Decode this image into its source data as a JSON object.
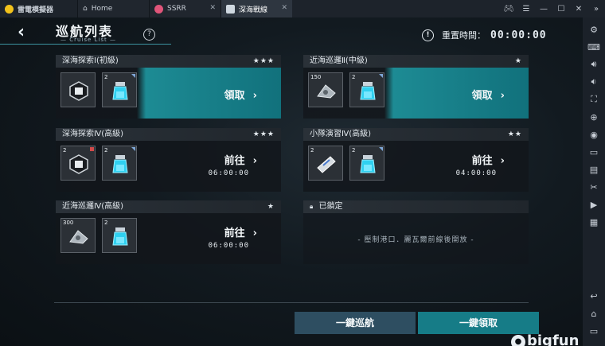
{
  "window": {
    "app_name": "雷電模擬器",
    "tabs": [
      {
        "label": "Home"
      },
      {
        "label": "SSRR"
      },
      {
        "label": "深海戰線"
      }
    ],
    "controls": [
      "gamepad-icon",
      "menu-icon",
      "minimize-icon",
      "maximize-icon",
      "close-icon",
      "collapse-icon"
    ]
  },
  "sidebar": {
    "icons": [
      "settings-icon",
      "keyboard-icon",
      "volume-up-icon",
      "volume-down-icon",
      "screenshot-icon",
      "add-app-icon",
      "record-icon",
      "folder-icon",
      "apk-icon",
      "scissors-icon",
      "video-icon",
      "multi-instance-icon",
      "back-icon",
      "home-icon",
      "recent-apps-icon"
    ]
  },
  "header": {
    "title": "巡航列表",
    "subtitle": "— Cruise List —",
    "help": "?",
    "reset_label": "重置時間：",
    "reset_time": "00:00:00"
  },
  "cards": [
    {
      "name": "深海探索Ⅰ(初級)",
      "stars": "★★★",
      "items": [
        {
          "count": "",
          "type": "cube"
        },
        {
          "count": "2",
          "type": "vial"
        }
      ],
      "action": "領取",
      "time": "",
      "claimable": true
    },
    {
      "name": "近海巡邏Ⅱ(中級)",
      "stars": "★",
      "items": [
        {
          "count": "150",
          "type": "part"
        },
        {
          "count": "2",
          "type": "vial"
        }
      ],
      "action": "領取",
      "time": "",
      "claimable": true
    },
    {
      "name": "深海探索Ⅳ(高級)",
      "stars": "★★★",
      "items": [
        {
          "count": "2",
          "type": "cube"
        },
        {
          "count": "2",
          "type": "vial"
        }
      ],
      "action": "前往",
      "time": "06:00:00",
      "claimable": false
    },
    {
      "name": "小隊演習Ⅳ(高級)",
      "stars": "★★",
      "items": [
        {
          "count": "2",
          "type": "ticket"
        },
        {
          "count": "2",
          "type": "vial"
        }
      ],
      "action": "前往",
      "time": "04:00:00",
      "claimable": false
    },
    {
      "name": "近海巡邏Ⅳ(高級)",
      "stars": "★",
      "items": [
        {
          "count": "300",
          "type": "part"
        },
        {
          "count": "2",
          "type": "vial"
        }
      ],
      "action": "前往",
      "time": "06:00:00",
      "claimable": false
    }
  ],
  "locked": {
    "label": "已鎖定",
    "text": "- 壓制港口．麗瓦爾前線後開放 -"
  },
  "buttons": {
    "cruise": "一鍵巡航",
    "claim_all": "一鍵領取"
  },
  "watermark": "bigfun"
}
